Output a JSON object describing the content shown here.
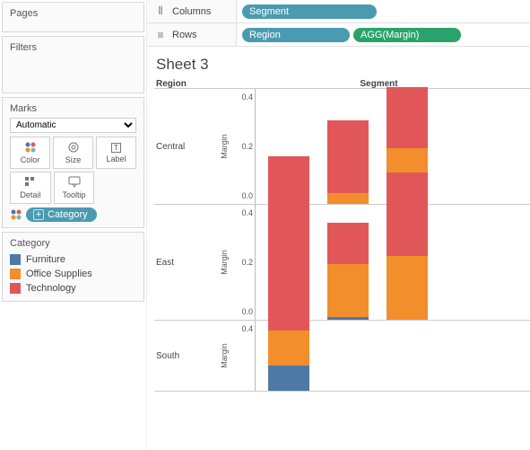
{
  "left": {
    "pages_title": "Pages",
    "filters_title": "Filters",
    "marks_title": "Marks",
    "marks_type": "Automatic",
    "mark_buttons": {
      "color": "Color",
      "size": "Size",
      "label": "Label",
      "detail": "Detail",
      "tooltip": "Tooltip"
    },
    "category_pill": "Category",
    "legend_title": "Category",
    "legend": [
      {
        "label": "Furniture",
        "color": "#4e79a7"
      },
      {
        "label": "Office Supplies",
        "color": "#f28e2b"
      },
      {
        "label": "Technology",
        "color": "#e15759"
      }
    ]
  },
  "shelves": {
    "columns_label": "Columns",
    "rows_label": "Rows",
    "columns_pills": [
      "Segment"
    ],
    "rows_pills": [
      {
        "label": "Region",
        "style": "pill-teal"
      },
      {
        "label": "AGG(Margin)",
        "style": "pill-green"
      }
    ]
  },
  "sheet": {
    "title": "Sheet 3",
    "region_header": "Region",
    "segment_header": "Segment",
    "y_title": "Margin"
  },
  "chart_data": {
    "type": "bar",
    "stacked": true,
    "facets_axis": "Region",
    "categories_axis": "Segment",
    "stack_axis": "Category",
    "ylabel": "Margin",
    "ylim": [
      0,
      0.4
    ],
    "yticks": [
      0.0,
      0.2,
      0.4
    ],
    "segments": 3,
    "facets": [
      {
        "name": "Central",
        "bars": [
          {
            "Furniture": 0.02,
            "Office Supplies": 0.02,
            "Technology": 0.13
          },
          {
            "Furniture": 0.0,
            "Office Supplies": 0.04,
            "Technology": 0.26
          },
          {
            "Furniture": 0.0,
            "Office Supplies": 0.2,
            "Technology": 0.22
          }
        ]
      },
      {
        "name": "East",
        "bars": [
          {
            "Furniture": 0.02,
            "Office Supplies": 0.18,
            "Technology": 0.15
          },
          {
            "Furniture": 0.01,
            "Office Supplies": 0.19,
            "Technology": 0.15
          },
          {
            "Furniture": 0.0,
            "Office Supplies": 0.23,
            "Technology": 0.3
          }
        ]
      },
      {
        "name": "South",
        "bars": [
          {
            "Furniture": 0.05,
            "Office Supplies": 0.07,
            "Technology": 0.3
          },
          {
            "Furniture": 0.0,
            "Office Supplies": 0.0,
            "Technology": 0.0
          },
          {
            "Furniture": 0.0,
            "Office Supplies": 0.0,
            "Technology": 0.0
          }
        ]
      }
    ]
  }
}
